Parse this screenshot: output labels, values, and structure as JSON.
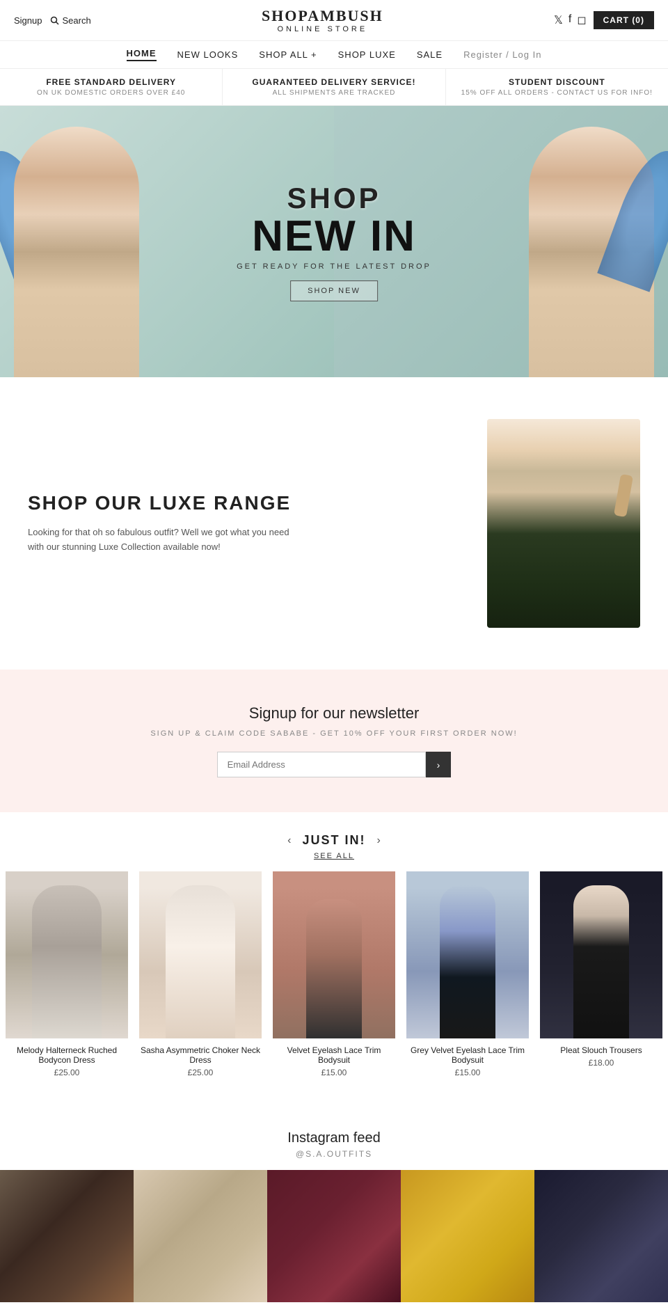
{
  "topbar": {
    "signup": "Signup",
    "search": "Search",
    "logo_main": "SHOPAMBUSH",
    "logo_sub": "ONLINE STORE",
    "cart_label": "CART",
    "cart_count": "(0)"
  },
  "nav": {
    "items": [
      {
        "label": "HOME",
        "active": true
      },
      {
        "label": "NEW LOOKS",
        "active": false
      },
      {
        "label": "SHOP ALL +",
        "active": false
      },
      {
        "label": "SHOP LUXE",
        "active": false
      },
      {
        "label": "SALE",
        "active": false
      },
      {
        "label": "Register / Log In",
        "active": false
      }
    ]
  },
  "promo": [
    {
      "title": "FREE STANDARD DELIVERY",
      "sub": "ON UK DOMESTIC ORDERS OVER £40"
    },
    {
      "title": "GUARANTEED DELIVERY SERVICE!",
      "sub": "ALL SHIPMENTS ARE TRACKED"
    },
    {
      "title": "STUDENT DISCOUNT",
      "sub": "15% OFF ALL ORDERS - CONTACT US FOR INFO!"
    }
  ],
  "hero": {
    "line1": "SHOP",
    "line2": "NEW IN",
    "sub": "GET READY FOR THE LATEST DROP",
    "btn": "SHOP NEW"
  },
  "luxe": {
    "title": "SHOP OUR LUXE RANGE",
    "desc": "Looking for that oh so fabulous outfit? Well we got what you need with our stunning Luxe Collection available now!"
  },
  "newsletter": {
    "title": "Signup for our newsletter",
    "sub": "SIGN UP & CLAIM CODE SABABE - GET 10% OFF YOUR FIRST ORDER NOW!",
    "placeholder": "Email Address",
    "submit_icon": "›"
  },
  "just_in": {
    "title": "JUST IN!",
    "see_all": "SEE ALL",
    "prev": "‹",
    "next": "›",
    "products": [
      {
        "name": "Melody Halterneck Ruched Bodycon Dress",
        "price": "£25.00"
      },
      {
        "name": "Sasha Asymmetric Choker Neck Dress",
        "price": "£25.00"
      },
      {
        "name": "Velvet Eyelash Lace Trim Bodysuit",
        "price": "£15.00"
      },
      {
        "name": "Grey Velvet Eyelash Lace Trim Bodysuit",
        "price": "£15.00"
      },
      {
        "name": "Pleat Slouch Trousers",
        "price": "£18.00"
      }
    ]
  },
  "instagram": {
    "title": "Instagram feed",
    "handle": "@S.A.OUTFITS"
  }
}
